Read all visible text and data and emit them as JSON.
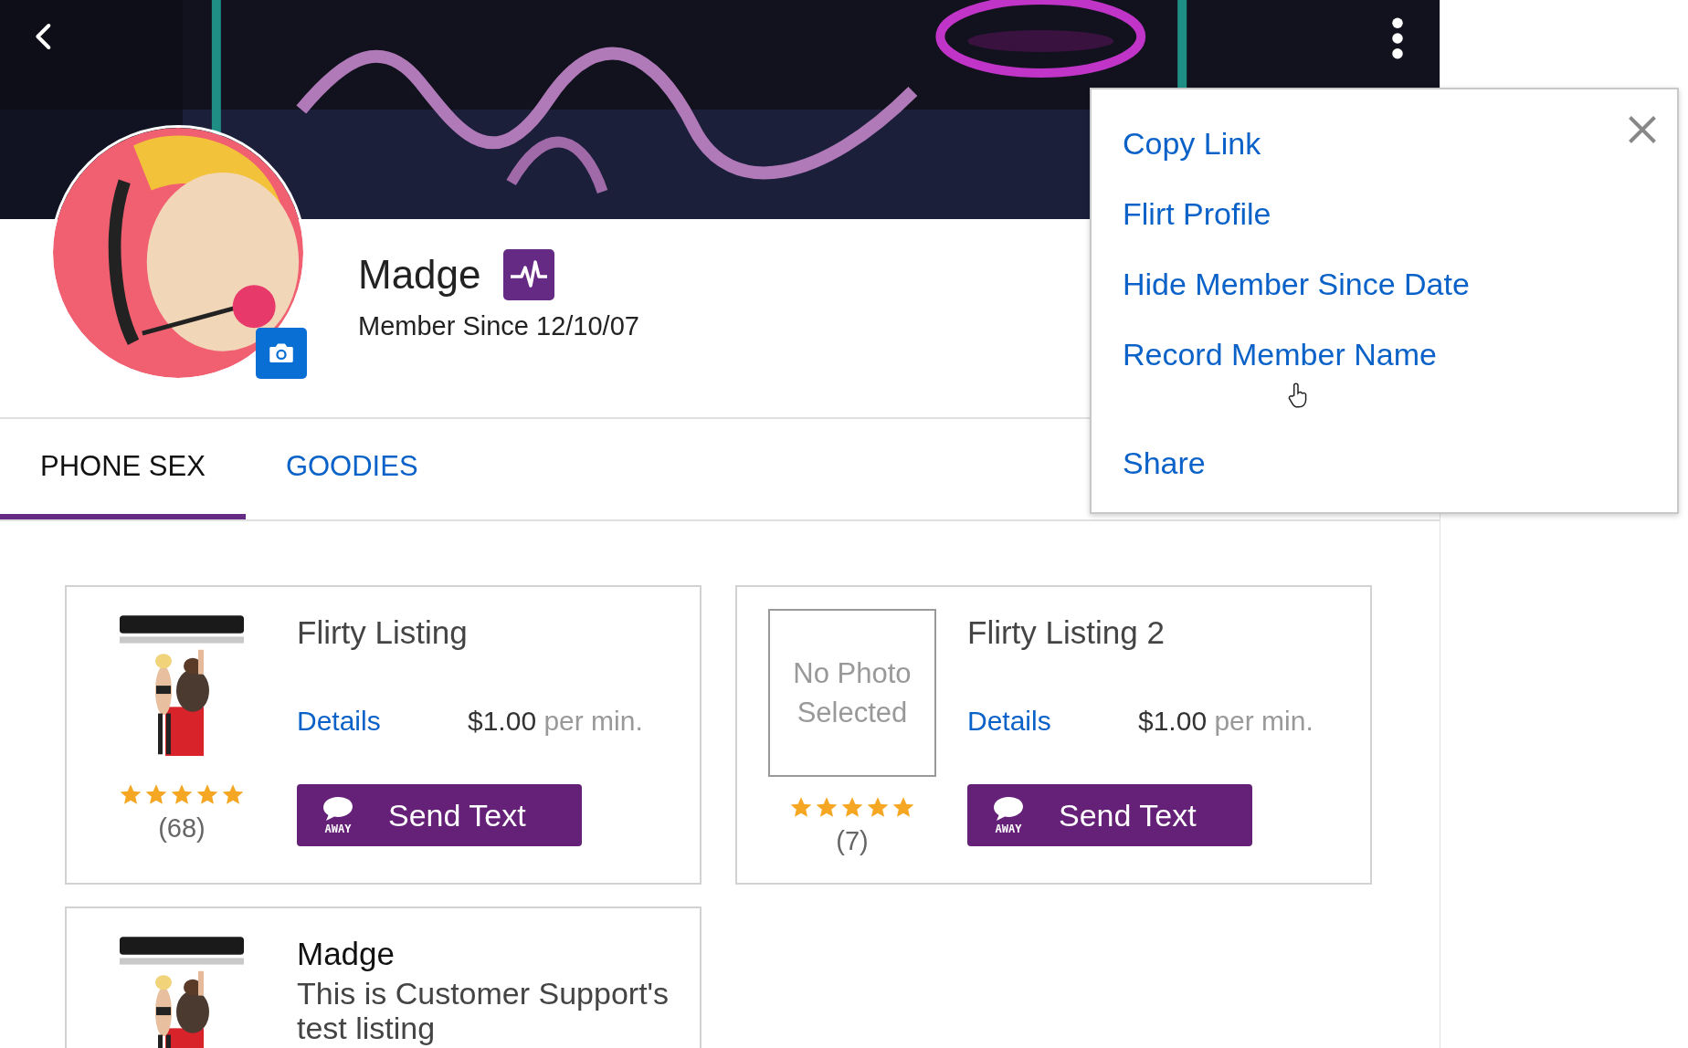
{
  "profile": {
    "name": "Madge",
    "member_since": "Member Since 12/10/07"
  },
  "tabs": [
    {
      "label": "PHONE SEX",
      "selected": true
    },
    {
      "label": "GOODIES",
      "selected": false
    }
  ],
  "listings": [
    {
      "kind": "call",
      "title": "Flirty Listing",
      "details": "Details",
      "price": "$1.00",
      "price_unit": "per min.",
      "stars": 5,
      "review_count": "(68)",
      "button": {
        "status": "AWAY",
        "label": "Send Text"
      }
    },
    {
      "kind": "call",
      "no_photo_text": "No Photo Selected",
      "title": "Flirty Listing 2",
      "details": "Details",
      "price": "$1.00",
      "price_unit": "per min.",
      "stars": 5,
      "review_count": "(7)",
      "button": {
        "status": "AWAY",
        "label": "Send Text"
      }
    },
    {
      "kind": "info",
      "title": "Madge",
      "description": "This is Customer Support's test listing"
    }
  ],
  "menu": {
    "items": [
      {
        "label": "Copy Link"
      },
      {
        "label": "Flirt Profile"
      },
      {
        "label": "Hide Member Since Date"
      },
      {
        "label": "Record Member Name"
      },
      {
        "label": "Share"
      }
    ]
  }
}
